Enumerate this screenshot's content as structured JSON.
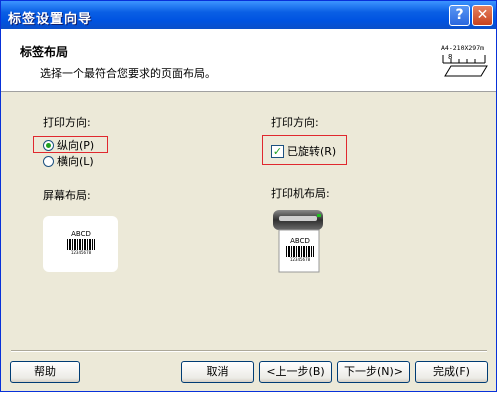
{
  "window": {
    "title": "标签设置向导"
  },
  "header": {
    "title": "标签布局",
    "subtitle": "选择一个最符合您要求的页面布局。",
    "paper_size": "A4-210X297m"
  },
  "left": {
    "orientation_label": "打印方向:",
    "portrait_label": "纵向(P)",
    "landscape_label": "横向(L)",
    "screen_layout_label": "屏幕布局:",
    "preview_text": "ABCD",
    "preview_number": "12345678"
  },
  "right": {
    "orientation_label": "打印方向:",
    "rotated_label": "已旋转(R)",
    "printer_layout_label": "打印机布局:",
    "preview_text": "ABCD",
    "preview_number": "12345678"
  },
  "buttons": {
    "help": "帮助",
    "cancel": "取消",
    "back": "<上一步(B)",
    "next": "下一步(N)>",
    "finish": "完成(F)"
  }
}
